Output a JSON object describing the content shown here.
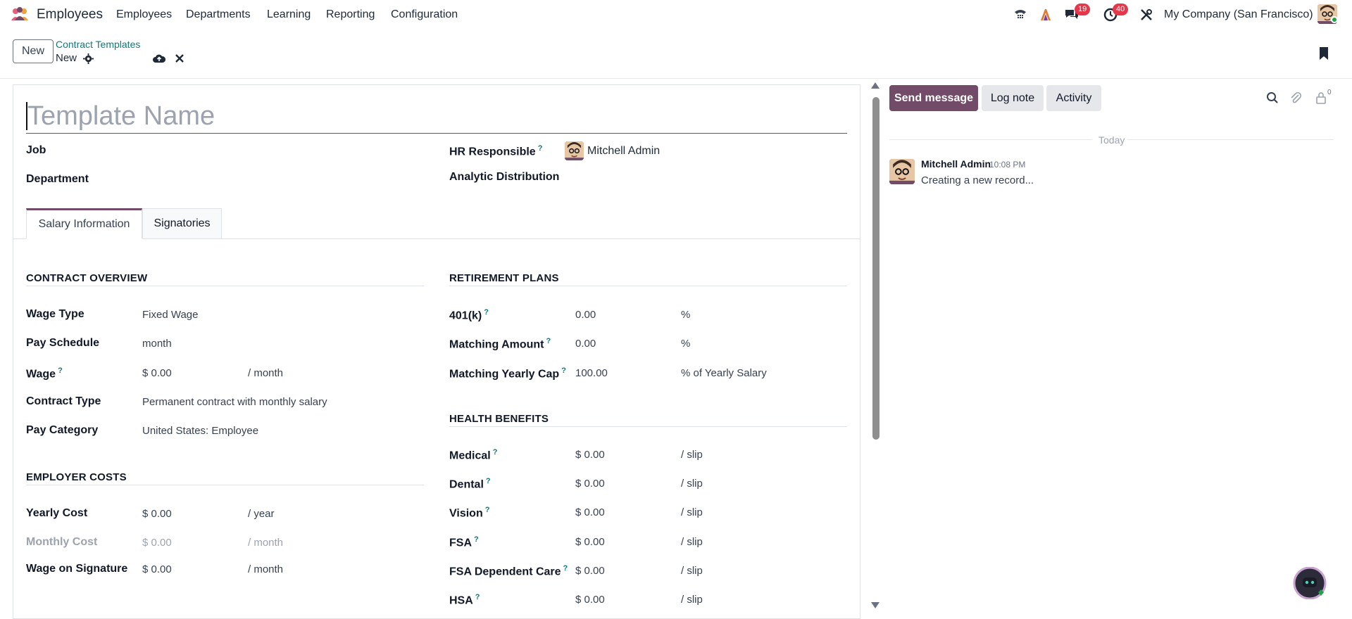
{
  "navbar": {
    "app_name": "Employees",
    "menu": [
      "Employees",
      "Departments",
      "Learning",
      "Reporting",
      "Configuration"
    ],
    "messages_badge": "19",
    "activities_badge": "40",
    "company": "My Company (San Francisco)"
  },
  "control_panel": {
    "new_label": "New",
    "breadcrumb_parent": "Contract Templates",
    "breadcrumb_current": "New"
  },
  "form": {
    "title_placeholder": "Template Name",
    "job_label": "Job",
    "department_label": "Department",
    "hr_responsible_label": "HR Responsible",
    "hr_responsible_value": "Mitchell Admin",
    "analytic_label": "Analytic Distribution",
    "tabs": [
      "Salary Information",
      "Signatories"
    ],
    "contract_overview": {
      "title": "CONTRACT OVERVIEW",
      "rows": [
        {
          "label": "Wage Type",
          "value": "Fixed Wage",
          "unit": ""
        },
        {
          "label": "Pay Schedule",
          "value": "month",
          "unit": ""
        },
        {
          "label": "Wage",
          "value": "$ 0.00",
          "unit": "/ month"
        },
        {
          "label": "Contract Type",
          "value": "Permanent contract with monthly salary",
          "unit": ""
        },
        {
          "label": "Pay Category",
          "value": "United States: Employee",
          "unit": ""
        }
      ]
    },
    "employer_costs": {
      "title": "EMPLOYER COSTS",
      "rows": [
        {
          "label": "Yearly Cost",
          "value": "$ 0.00",
          "unit": "/ year"
        },
        {
          "label": "Monthly Cost",
          "value": "$ 0.00",
          "unit": "/ month"
        },
        {
          "label": "Wage on Signature",
          "value": "$ 0.00",
          "unit": "/ month"
        }
      ]
    },
    "retirement_plans": {
      "title": "RETIREMENT PLANS",
      "rows": [
        {
          "label": "401(k)",
          "value": "0.00",
          "unit": "%"
        },
        {
          "label": "Matching Amount",
          "value": "0.00",
          "unit": "%"
        },
        {
          "label": "Matching Yearly Cap",
          "value": "100.00",
          "unit": "% of Yearly Salary"
        }
      ]
    },
    "health_benefits": {
      "title": "HEALTH BENEFITS",
      "rows": [
        {
          "label": "Medical",
          "value": "$ 0.00",
          "unit": "/ slip"
        },
        {
          "label": "Dental",
          "value": "$ 0.00",
          "unit": "/ slip"
        },
        {
          "label": "Vision",
          "value": "$ 0.00",
          "unit": "/ slip"
        },
        {
          "label": "FSA",
          "value": "$ 0.00",
          "unit": "/ slip"
        },
        {
          "label": "FSA Dependent Care",
          "value": "$ 0.00",
          "unit": "/ slip"
        },
        {
          "label": "HSA",
          "value": "$ 0.00",
          "unit": "/ slip"
        }
      ]
    },
    "help_mark": "?"
  },
  "chatter": {
    "send_message": "Send message",
    "log_note": "Log note",
    "activity": "Activity",
    "followers_count": "0",
    "date_separator": "Today",
    "message": {
      "author": "Mitchell Admin",
      "time": "10:08 PM",
      "body": "Creating a new record..."
    }
  },
  "colors": {
    "brand": "#714b67",
    "link": "#0f7a7a",
    "badge": "#e4374a"
  }
}
